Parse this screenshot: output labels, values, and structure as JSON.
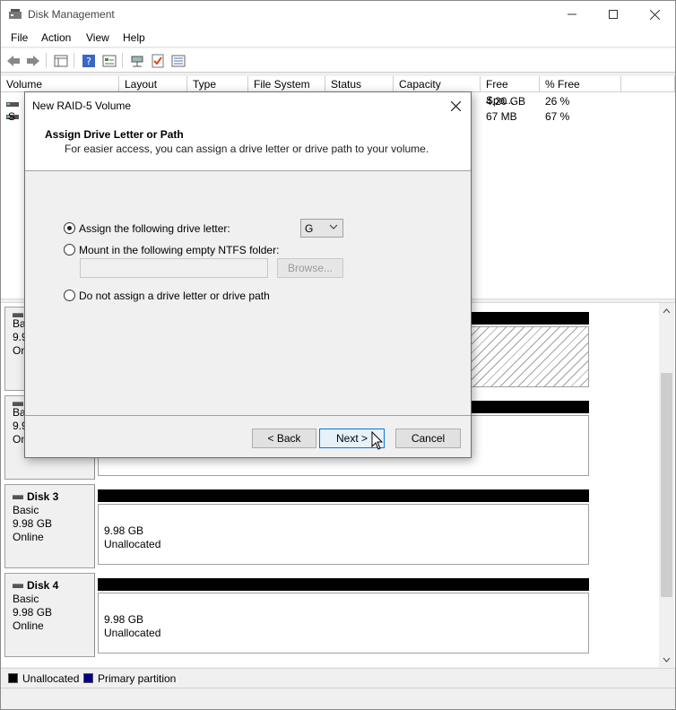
{
  "window": {
    "title": "Disk Management"
  },
  "menu": [
    "File",
    "Action",
    "View",
    "Help"
  ],
  "volume_table": {
    "columns": [
      "Volume",
      "Layout",
      "Type",
      "File System",
      "Status",
      "Capacity",
      "Free Spa...",
      "% Free"
    ],
    "rows": [
      {
        "free": "4.20 GB",
        "pct": "26 %"
      },
      {
        "free": "67 MB",
        "pct": "67 %"
      }
    ],
    "partial_labels": [
      "",
      "S"
    ]
  },
  "disks": [
    {
      "name": "",
      "type": "Basi",
      "size": "9.9",
      "status": "Onl"
    },
    {
      "name": "",
      "type": "Basi",
      "size": "9.9",
      "status": "Onl"
    },
    {
      "name": "Disk 3",
      "type": "Basic",
      "size": "9.98 GB",
      "status": "Online",
      "part_size": "9.98 GB",
      "part_label": "Unallocated"
    },
    {
      "name": "Disk 4",
      "type": "Basic",
      "size": "9.98 GB",
      "status": "Online",
      "part_size": "9.98 GB",
      "part_label": "Unallocated"
    }
  ],
  "legend": [
    {
      "label": "Unallocated",
      "color": "#000000"
    },
    {
      "label": "Primary partition",
      "color": "#000080"
    }
  ],
  "dialog": {
    "title": "New RAID-5 Volume",
    "heading": "Assign Drive Letter or Path",
    "subheading": "For easier access, you can assign a drive letter or drive path to your volume.",
    "option_letter": "Assign the following drive letter:",
    "drive_letter": "G",
    "option_folder": "Mount in the following empty NTFS folder:",
    "browse_label": "Browse...",
    "option_none": "Do not assign a drive letter or drive path",
    "back_label": "< Back",
    "next_label": "Next >",
    "cancel_label": "Cancel"
  }
}
